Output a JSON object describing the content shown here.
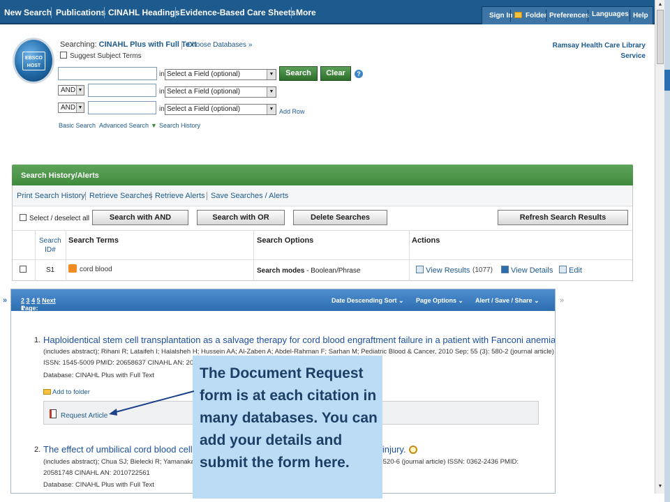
{
  "topnav": {
    "items": [
      "New Search",
      "Publications",
      "CINAHL Headings",
      "Evidence-Based Care Sheets",
      "More"
    ],
    "right_items": [
      "Sign In",
      "Folder",
      "Preferences",
      "Languages",
      "Help"
    ]
  },
  "logo_text": "EBSCO HOST",
  "search": {
    "searching_label": "Searching:",
    "database": "CINAHL Plus with Full Text",
    "choose_databases": "Choose Databases »",
    "suggest_subject_terms": "Suggest Subject Terms",
    "in_label": "in",
    "field_placeholder": "Select a Field (optional)",
    "bool_operator": "AND",
    "search_button": "Search",
    "clear_button": "Clear",
    "add_row": "Add Row",
    "basic_search": "Basic Search",
    "advanced_search": "Advanced Search",
    "search_history": "Search History"
  },
  "library": {
    "line1": "Ramsay Health Care Library",
    "line2": "Service"
  },
  "history": {
    "title": "Search History/Alerts",
    "links": [
      "Print Search History",
      "Retrieve Searches",
      "Retrieve Alerts",
      "Save Searches / Alerts"
    ],
    "select_all": "Select / deselect all",
    "buttons": [
      "Search with AND",
      "Search with OR",
      "Delete Searches",
      "Refresh Search Results"
    ],
    "columns": {
      "search_id_1": "Search",
      "search_id_2": "ID#",
      "terms": "Search Terms",
      "options": "Search Options",
      "actions": "Actions"
    },
    "row": {
      "id": "S1",
      "terms": "cord blood",
      "options_label": "Search modes",
      "options_value": " - Boolean/Phrase",
      "view_results": "View Results",
      "result_count": "(1077)",
      "view_details": "View Details",
      "edit": "Edit"
    }
  },
  "results": {
    "page_label": "Page:",
    "pages": [
      "1",
      "2",
      "3",
      "4",
      "5"
    ],
    "next": "Next",
    "sort": "Date Descending Sort ⌄",
    "page_options": "Page Options ⌄",
    "alert_share": "Alert / Save / Share ⌄",
    "items": [
      {
        "num": "1.",
        "title": "Haploidentical stem cell transplantation as a salvage therapy for cord blood engraftment failure in a patient with Fanconi anemia.",
        "meta1": "(includes abstract); Rihani R; Lataifeh I; Halalsheh H; Hussein AA; Al-Zaben A; Abdel-Rahman F; Sarhan M; Pediatric Blood & Cancer, 2010 Sep; 55 (3): 580-2 (journal article)",
        "meta2": "ISSN: 1545-5009 PMID: 20658637 CINAHL AN: 2010",
        "database": "Database: CINAHL Plus with Full Text",
        "add_folder": "Add to folder",
        "request": "Request Article"
      },
      {
        "num": "2.",
        "title_a": "The effect of umbilical cord blood cells o",
        "title_b": "d injury.",
        "meta1_a": "(includes abstract); Chua SJ; Bielecki R; Yamanaka N",
        "meta1_b": ".520-6 (journal article) ISSN: 0362-2436 PMID:",
        "meta2": "20581748 CINAHL AN: 2010722561",
        "database": "Database: CINAHL Plus with Full Text"
      }
    ]
  },
  "callout": {
    "text": "The Document Request form is at each citation in many databases. You can add your details and submit the form here."
  },
  "colors": {
    "nav_blue": "#1d5a8e",
    "green": "#3f8a3c",
    "callout_bg": "#bcdcf5"
  }
}
